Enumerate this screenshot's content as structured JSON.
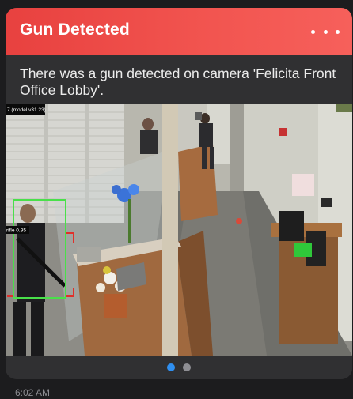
{
  "notification": {
    "title": "Gun Detected",
    "more_icon": "ellipsis-icon",
    "message": "There was a gun detected on camera 'Felicita Front Office Lobby'.",
    "timestamp": "6:02 AM"
  },
  "camera": {
    "model_label": "7 (model v31.23)",
    "detection_label": "rifle 0.95",
    "detection_color": "#49e04a",
    "secondary_box_color": "#e0302a"
  },
  "pager": {
    "active_index": 0,
    "count": 2,
    "active_color": "#2f8ff0",
    "inactive_color": "#8e8e93"
  },
  "colors": {
    "header_start": "#e8413f",
    "header_end": "#f6605b",
    "card_bg": "#303032",
    "page_bg": "#1c1c1e"
  }
}
